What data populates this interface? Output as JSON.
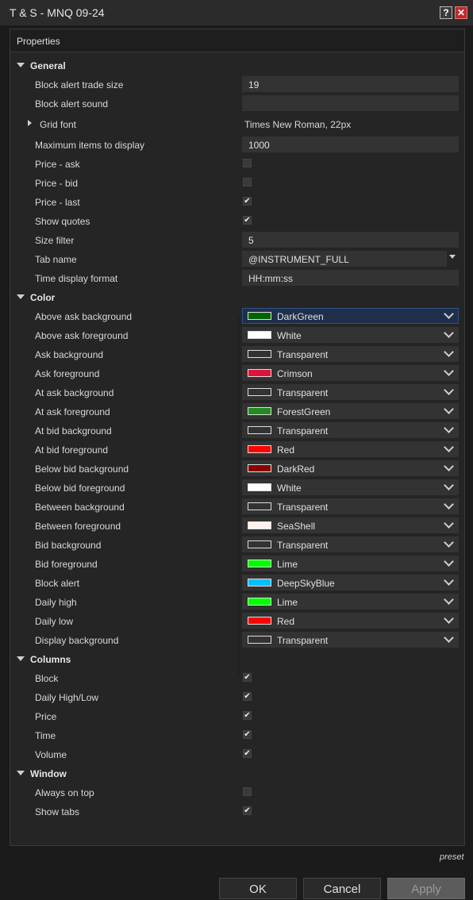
{
  "window": {
    "title": "T & S - MNQ 09-24",
    "help_glyph": "?",
    "close_glyph": "✕"
  },
  "panel": {
    "header": "Properties"
  },
  "general": {
    "header": "General",
    "block_alert_trade_size": {
      "label": "Block alert trade size",
      "value": "19"
    },
    "block_alert_sound": {
      "label": "Block alert sound",
      "value": ""
    },
    "grid_font": {
      "label": "Grid font",
      "value": "Times New Roman, 22px"
    },
    "maximum_items": {
      "label": "Maximum items to display",
      "value": "1000"
    },
    "price_ask": {
      "label": "Price - ask",
      "checked": false
    },
    "price_bid": {
      "label": "Price - bid",
      "checked": false
    },
    "price_last": {
      "label": "Price - last",
      "checked": true
    },
    "show_quotes": {
      "label": "Show quotes",
      "checked": true
    },
    "size_filter": {
      "label": "Size filter",
      "value": "5"
    },
    "tab_name": {
      "label": "Tab name",
      "value": "@INSTRUMENT_FULL"
    },
    "time_display_format": {
      "label": "Time display format",
      "value": "HH:mm:ss"
    }
  },
  "color": {
    "header": "Color",
    "items": [
      {
        "label": "Above ask background",
        "value": "DarkGreen",
        "hex": "#006400"
      },
      {
        "label": "Above ask foreground",
        "value": "White",
        "hex": "#ffffff"
      },
      {
        "label": "Ask background",
        "value": "Transparent",
        "hex": "transparent"
      },
      {
        "label": "Ask foreground",
        "value": "Crimson",
        "hex": "#dc143c"
      },
      {
        "label": "At ask background",
        "value": "Transparent",
        "hex": "transparent"
      },
      {
        "label": "At ask foreground",
        "value": "ForestGreen",
        "hex": "#228b22"
      },
      {
        "label": "At bid background",
        "value": "Transparent",
        "hex": "transparent"
      },
      {
        "label": "At bid foreground",
        "value": "Red",
        "hex": "#ff0000"
      },
      {
        "label": "Below bid background",
        "value": "DarkRed",
        "hex": "#8b0000"
      },
      {
        "label": "Below bid foreground",
        "value": "White",
        "hex": "#ffffff"
      },
      {
        "label": "Between background",
        "value": "Transparent",
        "hex": "transparent"
      },
      {
        "label": "Between foreground",
        "value": "SeaShell",
        "hex": "#fff5ee"
      },
      {
        "label": "Bid background",
        "value": "Transparent",
        "hex": "transparent"
      },
      {
        "label": "Bid foreground",
        "value": "Lime",
        "hex": "#00ff00"
      },
      {
        "label": "Block alert",
        "value": "DeepSkyBlue",
        "hex": "#00bfff"
      },
      {
        "label": "Daily high",
        "value": "Lime",
        "hex": "#00ff00"
      },
      {
        "label": "Daily low",
        "value": "Red",
        "hex": "#ff0000"
      },
      {
        "label": "Display background",
        "value": "Transparent",
        "hex": "transparent"
      }
    ]
  },
  "columns": {
    "header": "Columns",
    "items": [
      {
        "label": "Block",
        "checked": true
      },
      {
        "label": "Daily High/Low",
        "checked": true
      },
      {
        "label": "Price",
        "checked": true
      },
      {
        "label": "Time",
        "checked": true
      },
      {
        "label": "Volume",
        "checked": true
      }
    ]
  },
  "window_section": {
    "header": "Window",
    "items": [
      {
        "label": "Always on top",
        "checked": false
      },
      {
        "label": "Show tabs",
        "checked": true
      }
    ]
  },
  "footer": {
    "preset": "preset",
    "ok": "OK",
    "cancel": "Cancel",
    "apply": "Apply"
  },
  "check_glyph": "✔"
}
